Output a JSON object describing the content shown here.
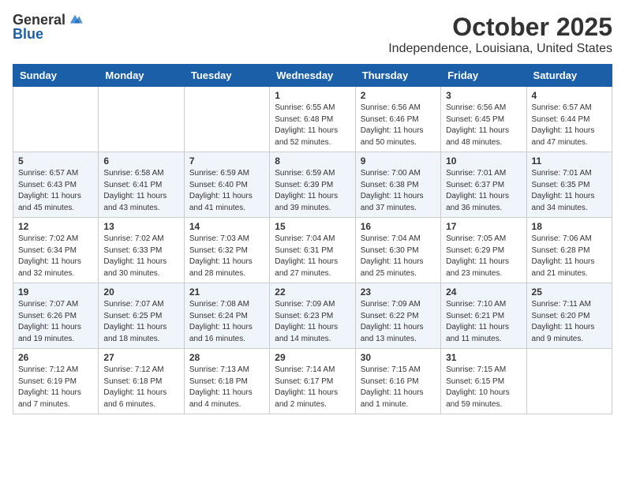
{
  "header": {
    "logo_general": "General",
    "logo_blue": "Blue",
    "month_title": "October 2025",
    "location": "Independence, Louisiana, United States"
  },
  "weekdays": [
    "Sunday",
    "Monday",
    "Tuesday",
    "Wednesday",
    "Thursday",
    "Friday",
    "Saturday"
  ],
  "weeks": [
    [
      {
        "day": "",
        "info": ""
      },
      {
        "day": "",
        "info": ""
      },
      {
        "day": "",
        "info": ""
      },
      {
        "day": "1",
        "info": "Sunrise: 6:55 AM\nSunset: 6:48 PM\nDaylight: 11 hours\nand 52 minutes."
      },
      {
        "day": "2",
        "info": "Sunrise: 6:56 AM\nSunset: 6:46 PM\nDaylight: 11 hours\nand 50 minutes."
      },
      {
        "day": "3",
        "info": "Sunrise: 6:56 AM\nSunset: 6:45 PM\nDaylight: 11 hours\nand 48 minutes."
      },
      {
        "day": "4",
        "info": "Sunrise: 6:57 AM\nSunset: 6:44 PM\nDaylight: 11 hours\nand 47 minutes."
      }
    ],
    [
      {
        "day": "5",
        "info": "Sunrise: 6:57 AM\nSunset: 6:43 PM\nDaylight: 11 hours\nand 45 minutes."
      },
      {
        "day": "6",
        "info": "Sunrise: 6:58 AM\nSunset: 6:41 PM\nDaylight: 11 hours\nand 43 minutes."
      },
      {
        "day": "7",
        "info": "Sunrise: 6:59 AM\nSunset: 6:40 PM\nDaylight: 11 hours\nand 41 minutes."
      },
      {
        "day": "8",
        "info": "Sunrise: 6:59 AM\nSunset: 6:39 PM\nDaylight: 11 hours\nand 39 minutes."
      },
      {
        "day": "9",
        "info": "Sunrise: 7:00 AM\nSunset: 6:38 PM\nDaylight: 11 hours\nand 37 minutes."
      },
      {
        "day": "10",
        "info": "Sunrise: 7:01 AM\nSunset: 6:37 PM\nDaylight: 11 hours\nand 36 minutes."
      },
      {
        "day": "11",
        "info": "Sunrise: 7:01 AM\nSunset: 6:35 PM\nDaylight: 11 hours\nand 34 minutes."
      }
    ],
    [
      {
        "day": "12",
        "info": "Sunrise: 7:02 AM\nSunset: 6:34 PM\nDaylight: 11 hours\nand 32 minutes."
      },
      {
        "day": "13",
        "info": "Sunrise: 7:02 AM\nSunset: 6:33 PM\nDaylight: 11 hours\nand 30 minutes."
      },
      {
        "day": "14",
        "info": "Sunrise: 7:03 AM\nSunset: 6:32 PM\nDaylight: 11 hours\nand 28 minutes."
      },
      {
        "day": "15",
        "info": "Sunrise: 7:04 AM\nSunset: 6:31 PM\nDaylight: 11 hours\nand 27 minutes."
      },
      {
        "day": "16",
        "info": "Sunrise: 7:04 AM\nSunset: 6:30 PM\nDaylight: 11 hours\nand 25 minutes."
      },
      {
        "day": "17",
        "info": "Sunrise: 7:05 AM\nSunset: 6:29 PM\nDaylight: 11 hours\nand 23 minutes."
      },
      {
        "day": "18",
        "info": "Sunrise: 7:06 AM\nSunset: 6:28 PM\nDaylight: 11 hours\nand 21 minutes."
      }
    ],
    [
      {
        "day": "19",
        "info": "Sunrise: 7:07 AM\nSunset: 6:26 PM\nDaylight: 11 hours\nand 19 minutes."
      },
      {
        "day": "20",
        "info": "Sunrise: 7:07 AM\nSunset: 6:25 PM\nDaylight: 11 hours\nand 18 minutes."
      },
      {
        "day": "21",
        "info": "Sunrise: 7:08 AM\nSunset: 6:24 PM\nDaylight: 11 hours\nand 16 minutes."
      },
      {
        "day": "22",
        "info": "Sunrise: 7:09 AM\nSunset: 6:23 PM\nDaylight: 11 hours\nand 14 minutes."
      },
      {
        "day": "23",
        "info": "Sunrise: 7:09 AM\nSunset: 6:22 PM\nDaylight: 11 hours\nand 13 minutes."
      },
      {
        "day": "24",
        "info": "Sunrise: 7:10 AM\nSunset: 6:21 PM\nDaylight: 11 hours\nand 11 minutes."
      },
      {
        "day": "25",
        "info": "Sunrise: 7:11 AM\nSunset: 6:20 PM\nDaylight: 11 hours\nand 9 minutes."
      }
    ],
    [
      {
        "day": "26",
        "info": "Sunrise: 7:12 AM\nSunset: 6:19 PM\nDaylight: 11 hours\nand 7 minutes."
      },
      {
        "day": "27",
        "info": "Sunrise: 7:12 AM\nSunset: 6:18 PM\nDaylight: 11 hours\nand 6 minutes."
      },
      {
        "day": "28",
        "info": "Sunrise: 7:13 AM\nSunset: 6:18 PM\nDaylight: 11 hours\nand 4 minutes."
      },
      {
        "day": "29",
        "info": "Sunrise: 7:14 AM\nSunset: 6:17 PM\nDaylight: 11 hours\nand 2 minutes."
      },
      {
        "day": "30",
        "info": "Sunrise: 7:15 AM\nSunset: 6:16 PM\nDaylight: 11 hours\nand 1 minute."
      },
      {
        "day": "31",
        "info": "Sunrise: 7:15 AM\nSunset: 6:15 PM\nDaylight: 10 hours\nand 59 minutes."
      },
      {
        "day": "",
        "info": ""
      }
    ]
  ]
}
